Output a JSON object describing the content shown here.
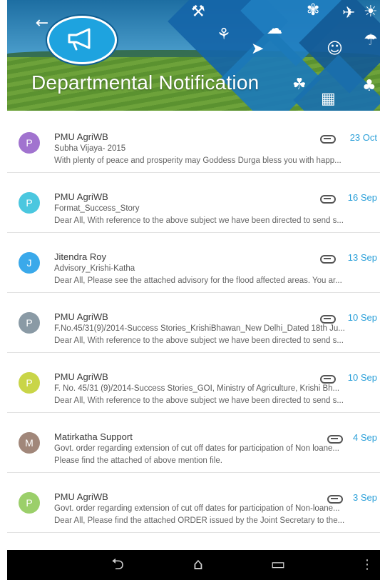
{
  "header": {
    "title": "Departmental Notification",
    "back_icon": "arrow-left-icon",
    "logo_icon": "megaphone-icon"
  },
  "notifications": [
    {
      "initial": "P",
      "color": "#a173cf",
      "sender": "PMU AgriWB",
      "subject": "Subha Vijaya- 2015",
      "preview": "With plenty of peace and prosperity may Goddess Durga bless  you with happ...",
      "date": "23 Oct"
    },
    {
      "initial": "P",
      "color": "#4bc7df",
      "sender": "PMU AgriWB",
      "subject": "Format_Success_Story",
      "preview": "Dear All, With reference to the above subject we  have been directed to send s...",
      "date": "16 Sep"
    },
    {
      "initial": "J",
      "color": "#3aa9ea",
      "sender": "Jitendra Roy",
      "subject": "Advisory_Krishi-Katha",
      "preview": "Dear All, Please see the attached advisory for the flood affected areas. You ar...",
      "date": "13 Sep"
    },
    {
      "initial": "P",
      "color": "#8a9aa5",
      "sender": "PMU AgriWB",
      "subject": "F.No.45/31(9)/2014-Success Stories_KrishiBhawan_New Delhi_Dated 18th Ju...",
      "preview": "Dear All, With reference to the above subject we  have been directed to send s...",
      "date": "10 Sep"
    },
    {
      "initial": "P",
      "color": "#c9d548",
      "sender": "PMU AgriWB",
      "subject": "F. No. 45/31 (9)/2014-Success Stories_GOI, Ministry of Agriculture, Krishi Bh...",
      "preview": "Dear All, With reference to the above subject we  have been directed to send s...",
      "date": "10 Sep"
    },
    {
      "initial": "M",
      "color": "#a1877a",
      "sender": "Matirkatha Support",
      "subject": "Govt. order regarding extension of cut off dates for participation of Non loane...",
      "preview": "Please find the attached of above mention file.",
      "date": "4 Sep"
    },
    {
      "initial": "P",
      "color": "#9bcf6a",
      "sender": "PMU AgriWB",
      "subject": "Govt. order regarding extension of cut off dates for participation of Non-loane...",
      "preview": "Dear All, Please find the attached  ORDER issued by the Joint Secretary to the...",
      "date": "3 Sep"
    }
  ],
  "navbar": {
    "back": "back-icon",
    "home": "home-icon",
    "recent": "recent-apps-icon",
    "more": "overflow-menu-icon"
  }
}
